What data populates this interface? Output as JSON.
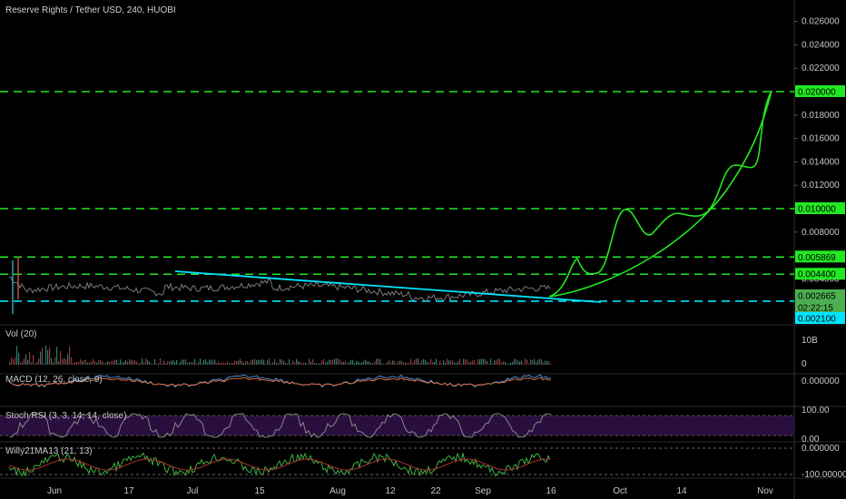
{
  "header": {
    "title": "Reserve Rights / Tether USD, 240, HUOBI"
  },
  "panels": {
    "vol": "Vol (20)",
    "macd": "MACD (12, 26, close, 9)",
    "stoch": "Stoch RSI (3, 3, 14, 14, close)",
    "willy": "Willy21MA13 (21, 13)"
  },
  "chart_data": {
    "type": "line",
    "y_ticks": [
      "0.026000",
      "0.024000",
      "0.022000",
      "0.020000",
      "0.018000",
      "0.016000",
      "0.014000",
      "0.012000",
      "0.010000",
      "0.008000",
      "0.006000",
      "0.004000"
    ],
    "x_ticks": [
      "Jun",
      "17",
      "Jul",
      "15",
      "Aug",
      "12",
      "22",
      "Sep",
      "16",
      "Oct",
      "14",
      "Nov"
    ],
    "ylim": [
      0.0015,
      0.027
    ],
    "price_labels": [
      {
        "text": "0.020000",
        "value": 0.02,
        "color": "#22e822"
      },
      {
        "text": "0.010000",
        "value": 0.01,
        "color": "#22e822"
      },
      {
        "text": "0.005869",
        "value": 0.005869,
        "color": "#22e822"
      },
      {
        "text": "0.004400",
        "value": 0.0044,
        "color": "#22e822"
      },
      {
        "text": "0.002665",
        "value": 0.002665,
        "color": "#4caf50"
      },
      {
        "text": "02:22:15",
        "value": 0.00175,
        "color": "#4caf50"
      },
      {
        "text": "0.002100",
        "value": 0.0021,
        "color": "#00e5ff"
      }
    ],
    "horizontal_levels": [
      {
        "value": 0.02,
        "color": "#22e822"
      },
      {
        "value": 0.01,
        "color": "#22e822"
      },
      {
        "value": 0.005869,
        "color": "#22e822"
      },
      {
        "value": 0.0044,
        "color": "#22e822"
      },
      {
        "value": 0.0021,
        "color": "#00e5ff"
      }
    ],
    "vol_ticks": [
      "10B",
      "0"
    ],
    "macd_ticks": [
      "0.000000"
    ],
    "stoch_ticks": [
      "100.00",
      "0.00"
    ],
    "willy_ticks": [
      "0.000000",
      "-100.000000"
    ],
    "colors": {
      "green": "#22e822",
      "cyan": "#00e5ff",
      "price": "#7a7a7a",
      "stoch_band": "#2a0f3e"
    }
  }
}
